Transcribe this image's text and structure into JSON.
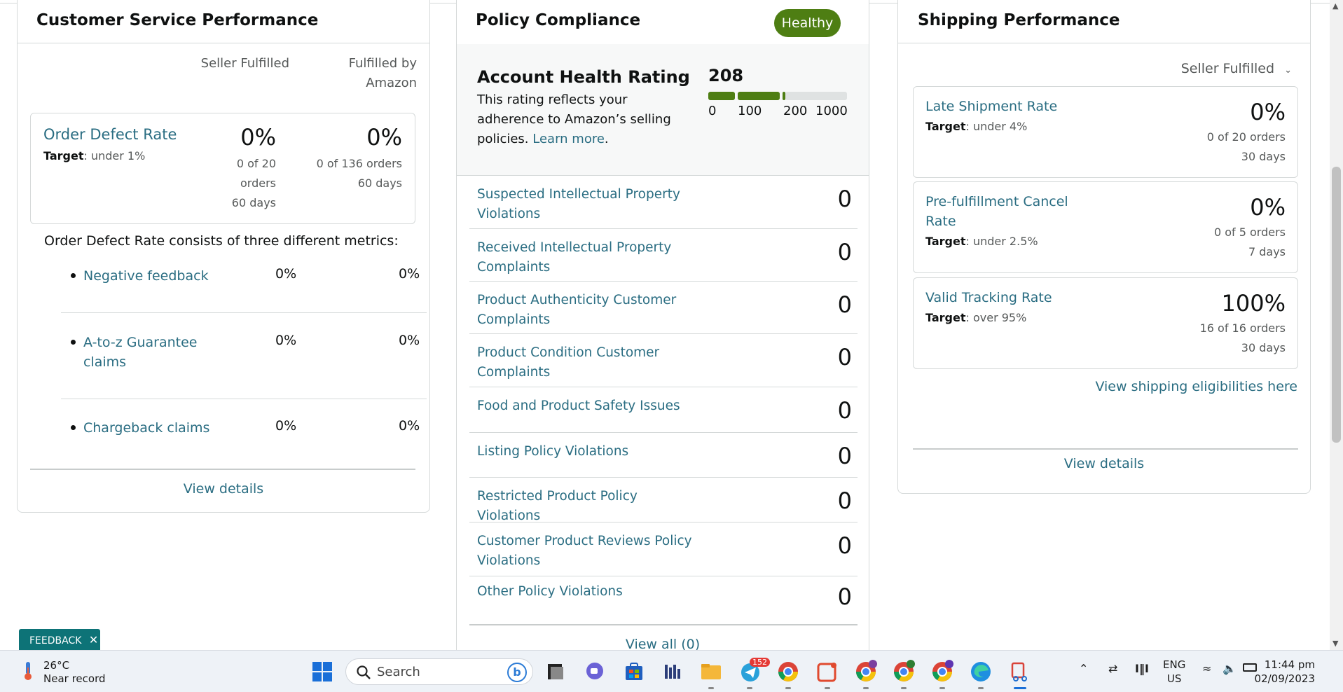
{
  "customer_service": {
    "title": "Customer Service Performance",
    "col_seller": "Seller Fulfilled",
    "col_fba_line1": "Fulfilled by",
    "col_fba_line2": "Amazon",
    "odr": {
      "label": "Order Defect Rate",
      "target_label": "Target",
      "target_value": ": under 1%",
      "seller_pct": "0%",
      "seller_sub1": "0 of 20",
      "seller_sub2": "orders",
      "seller_sub3": "60 days",
      "fba_pct": "0%",
      "fba_sub1": "0 of 136 orders",
      "fba_sub2": "60 days"
    },
    "intro": "Order Defect Rate consists of three different metrics:",
    "metrics": [
      {
        "label": "Negative feedback",
        "seller": "0%",
        "fba": "0%"
      },
      {
        "label": "A-to-z Guarantee claims",
        "seller": "0%",
        "fba": "0%"
      },
      {
        "label": "Chargeback claims",
        "seller": "0%",
        "fba": "0%"
      }
    ],
    "view_details": "View details"
  },
  "policy": {
    "title": "Policy Compliance",
    "badge": "Healthy",
    "ahr_title": "Account Health Rating",
    "ahr_desc": "This rating reflects your adherence to Amazon’s selling policies.",
    "ahr_learn_more": "Learn more",
    "ahr_period": ".",
    "score": "208",
    "ticks": [
      "0",
      "100",
      "200",
      "1000"
    ],
    "rows": [
      {
        "label": "Suspected Intellectual Property Violations",
        "count": "0"
      },
      {
        "label": "Received Intellectual Property Complaints",
        "count": "0"
      },
      {
        "label": "Product Authenticity Customer Complaints",
        "count": "0"
      },
      {
        "label": "Product Condition Customer Complaints",
        "count": "0"
      },
      {
        "label": "Food and Product Safety Issues",
        "count": "0"
      },
      {
        "label": "Listing Policy Violations",
        "count": "0"
      },
      {
        "label": "Restricted Product Policy Violations",
        "count": "0"
      },
      {
        "label": "Customer Product Reviews Policy Violations",
        "count": "0"
      },
      {
        "label": "Other Policy Violations",
        "count": "0"
      }
    ],
    "view_all": "View all (0)"
  },
  "shipping": {
    "title": "Shipping Performance",
    "filter": "Seller Fulfilled",
    "metrics": [
      {
        "label": "Late Shipment Rate",
        "target_label": "Target",
        "target_value": ": under 4%",
        "pct": "0%",
        "sub1": "0 of 20 orders",
        "sub2": "30 days"
      },
      {
        "label": "Pre-fulfillment Cancel Rate",
        "target_label": "Target",
        "target_value": ": under 2.5%",
        "pct": "0%",
        "sub1": "0 of 5 orders",
        "sub2": "7 days"
      },
      {
        "label": "Valid Tracking Rate",
        "target_label": "Target",
        "target_value": ": over 95%",
        "pct": "100%",
        "sub1": "16 of 16 orders",
        "sub2": "30 days"
      }
    ],
    "eligibilities": "View shipping eligibilities here",
    "view_details": "View details"
  },
  "feedback": {
    "label": "FEEDBACK"
  },
  "taskbar": {
    "weather_temp": "26°C",
    "weather_desc": "Near record",
    "search_placeholder": "Search",
    "telegram_badge": "152",
    "lang_line1": "ENG",
    "lang_line2": "US",
    "time": "11:44 pm",
    "date": "02/09/2023",
    "apps": [
      "windows-start-icon",
      "search-icon",
      "bing-icon",
      "task-view-icon",
      "chat-icon",
      "store-icon",
      "app-icon",
      "file-explorer-icon",
      "telegram-icon",
      "chrome-icon",
      "app-icon",
      "chrome-icon",
      "chrome-icon",
      "chrome-icon",
      "edge-icon",
      "snipping-tool-icon"
    ]
  },
  "colors": {
    "link": "#2a6d82",
    "healthy": "#4e7e13",
    "feedback": "#0d7377"
  }
}
